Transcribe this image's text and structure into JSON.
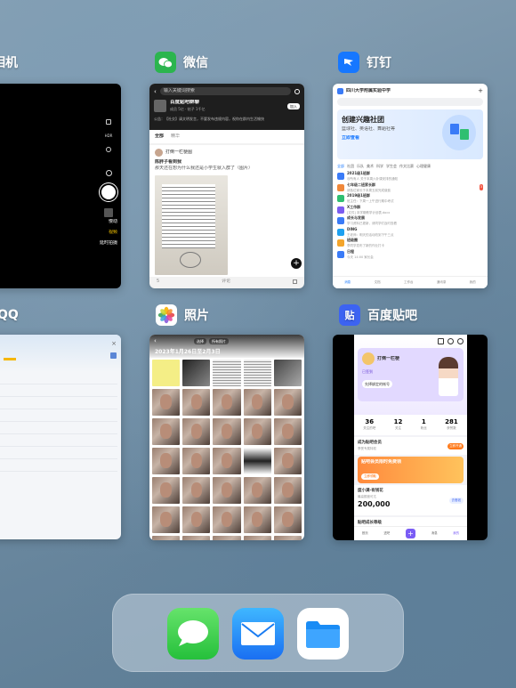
{
  "apps": {
    "camera": {
      "name": "相机",
      "modes": [
        "慢动",
        "视频",
        "延时拍摄"
      ]
    },
    "wechat": {
      "name": "微信",
      "search": "输入关键词搜索",
      "group_name": "百度贴吧群聊",
      "meta": "成员 5亿 · 帖子 1千亿",
      "join_button": "加入",
      "notice": "公告：【社交】请文明发言，不要发布违规内容，祝你在群内生活愉快",
      "tabs": [
        "全部",
        "精华"
      ],
      "user_name": "打倒一栏梗图",
      "post_title": "陈胖子看到我",
      "post_text": "那天还在想为什么我还是小学生就入群了（图片）",
      "likes": "5",
      "comments": "评论"
    },
    "dingtalk": {
      "name": "钉钉",
      "org": "四川大学附属实验中学",
      "banner_title": "创建兴趣社团",
      "banner_sub": "篮球社、英语社、舞蹈社等",
      "banner_button": "立即查看",
      "tabs": [
        "全部",
        "社团",
        "乐队",
        "美术",
        "科学",
        "学生会",
        "作文比赛",
        "心理健康"
      ],
      "list": [
        {
          "name": "2021级1班群",
          "text": "@所有人 关于本周六补课安排的通知",
          "badge": "",
          "color": "#3a7bf7"
        },
        {
          "name": "七年级二班家长群",
          "text": "请各位家长于本周五前完成缴费",
          "badge": "3",
          "color": "#f0883a"
        },
        {
          "name": "2019级1班群",
          "text": "班主任：下周一上午进行期中考试",
          "badge": "",
          "color": "#2fbf71"
        },
        {
          "name": "X工作群",
          "text": "[文件] 本学期教学计划表.docx",
          "badge": "",
          "color": "#7b5cf0"
        },
        {
          "name": "成长与发展",
          "text": "学习资料已更新，请同学们及时查看",
          "badge": "",
          "color": "#3a7bf7"
        },
        {
          "name": "DING",
          "text": "王老师：明天的活动改到下午三点",
          "badge": "",
          "color": "#1ea1f1"
        },
        {
          "name": "班级圈",
          "text": "李同学发布了新的作业打卡",
          "badge": "",
          "color": "#f4a52b"
        },
        {
          "name": "日程",
          "text": "今天 14:00 家长会",
          "badge": "",
          "color": "#3a7bf7"
        }
      ],
      "nav": [
        "消息",
        "文档",
        "工作台",
        "通讯录",
        "我的"
      ]
    },
    "qq": {
      "name": "QQ"
    },
    "photos": {
      "name": "照片",
      "date_range": "2023年1月26日至2月3日",
      "toolbar": [
        "选择",
        "所有照片"
      ]
    },
    "tieba": {
      "name": "百度贴吧",
      "username": "打倒一栏梗",
      "signin": "已签到",
      "bind": "先择绑定的帐号",
      "stats": [
        {
          "value": "36",
          "label": "关注的吧"
        },
        {
          "value": "12",
          "label": "关注"
        },
        {
          "value": "1",
          "label": "粉丝"
        },
        {
          "value": "281",
          "label": "获赞数"
        }
      ],
      "member_title": "成为贴吧会员",
      "member_sub": "享受专属特权",
      "member_button": "立即开通",
      "promo_title": "贴吧会员限时免费领",
      "promo_button": "立即领取",
      "shop_title": "度小满·有钱花",
      "shop_sub": "最高额度可达",
      "shop_amount": "200,000",
      "shop_button": "去借钱",
      "level": "贴吧成长等级",
      "nav": [
        "首页",
        "进吧",
        "发布",
        "消息",
        "我的"
      ]
    }
  },
  "dock": [
    {
      "name": "Messages",
      "icon": "messages-icon"
    },
    {
      "name": "Mail",
      "icon": "mail-icon"
    },
    {
      "name": "Files",
      "icon": "files-icon"
    }
  ]
}
